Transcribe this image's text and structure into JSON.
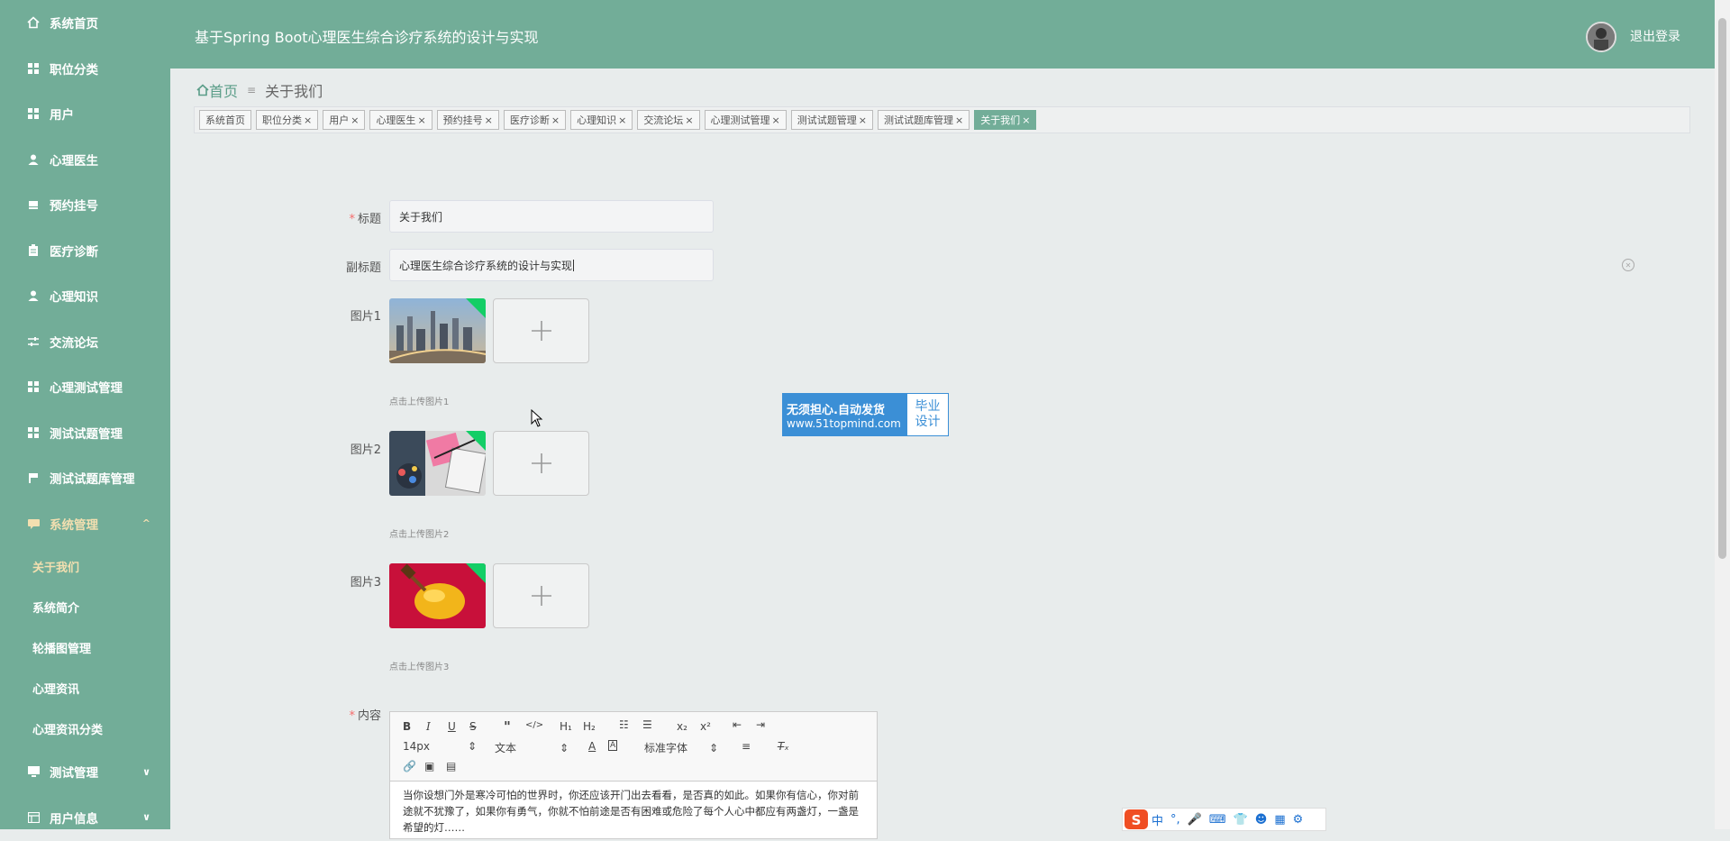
{
  "header": {
    "title": "基于Spring Boot心理医生综合诊疗系统的设计与实现",
    "logout": "退出登录"
  },
  "sidebar": {
    "items": [
      {
        "label": "系统首页",
        "icon": "home-icon"
      },
      {
        "label": "职位分类",
        "icon": "grid-icon"
      },
      {
        "label": "用户",
        "icon": "grid-icon"
      },
      {
        "label": "心理医生",
        "icon": "user-icon"
      },
      {
        "label": "预约挂号",
        "icon": "calendar-icon"
      },
      {
        "label": "医疗诊断",
        "icon": "clipboard-icon"
      },
      {
        "label": "心理知识",
        "icon": "user-icon"
      },
      {
        "label": "交流论坛",
        "icon": "sliders-icon"
      },
      {
        "label": "心理测试管理",
        "icon": "grid-icon"
      },
      {
        "label": "测试试题管理",
        "icon": "grid-icon"
      },
      {
        "label": "测试试题库管理",
        "icon": "flag-icon"
      }
    ],
    "group": {
      "label": "系统管理",
      "icon": "chat-icon",
      "chevron": "^"
    },
    "sub_items": [
      "关于我们",
      "系统简介",
      "轮播图管理",
      "心理资讯",
      "心理资讯分类"
    ],
    "bottom": [
      {
        "label": "测试管理",
        "icon": "monitor-icon",
        "chevron": "∨"
      },
      {
        "label": "用户信息",
        "icon": "table-icon",
        "chevron": "∨"
      }
    ]
  },
  "breadcrumb": {
    "home": "首页",
    "separator": "≡",
    "current": "关于我们"
  },
  "tabs": [
    {
      "label": "系统首页",
      "closable": false
    },
    {
      "label": "职位分类",
      "closable": true
    },
    {
      "label": "用户",
      "closable": true
    },
    {
      "label": "心理医生",
      "closable": true
    },
    {
      "label": "预约挂号",
      "closable": true
    },
    {
      "label": "医疗诊断",
      "closable": true
    },
    {
      "label": "心理知识",
      "closable": true
    },
    {
      "label": "交流论坛",
      "closable": true
    },
    {
      "label": "心理测试管理",
      "closable": true
    },
    {
      "label": "测试试题管理",
      "closable": true
    },
    {
      "label": "测试试题库管理",
      "closable": true
    },
    {
      "label": "关于我们",
      "closable": true
    }
  ],
  "form": {
    "title_label": "标题",
    "title_value": "关于我们",
    "subtitle_label": "副标题",
    "subtitle_value": "心理医生综合诊疗系统的设计与实现",
    "pic1_label": "图片1",
    "pic1_tip": "点击上传图片1",
    "pic2_label": "图片2",
    "pic2_tip": "点击上传图片2",
    "pic3_label": "图片3",
    "pic3_tip": "点击上传图片3",
    "content_label": "内容"
  },
  "editor": {
    "font_size": "14px",
    "text_type": "文本",
    "font_family": "标准字体",
    "content": "当你设想门外是寒冷可怕的世界时，你还应该开门出去看看，是否真的如此。如果你有信心，你对前途就不犹豫了，如果你有勇气，你就不怕前途是否有困难或危险了每个人心中都应有两盏灯，一盏是希望的灯……"
  },
  "ad": {
    "line1": "无须担心.自动发货",
    "line2": "www.51topmind.com",
    "right1": "毕业",
    "right2": "设计"
  },
  "ime": {
    "lang": "中"
  }
}
